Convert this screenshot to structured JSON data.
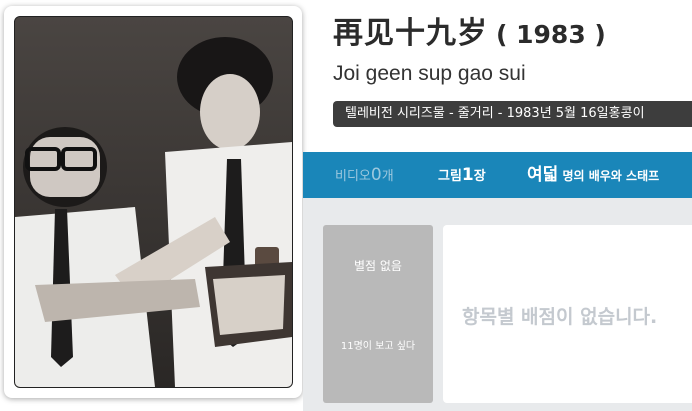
{
  "title": {
    "main": "再见十九岁",
    "year": "( 1983 )",
    "romanized": "Joi geen sup gao sui"
  },
  "meta": {
    "info": "텔레비전 시리즈물 - 줄거리 - 1983년 5월 16일홍콩이"
  },
  "stats": {
    "video_label": "비디오",
    "video_count": "0",
    "video_suffix": "개",
    "image_label": "그림",
    "image_count": "1",
    "image_suffix": "장",
    "cast_count": "여덟",
    "cast_label": "명의 배우와 스태프"
  },
  "rating": {
    "no_rating": "별점 없음",
    "want_to_see": "11명이 보고 싶다",
    "no_criteria": "항목별 배점이 없습니다."
  },
  "colors": {
    "stats_bar": "#1a86b9",
    "rating_box": "#b9b9b9",
    "meta_pill": "#3d3d3d"
  }
}
